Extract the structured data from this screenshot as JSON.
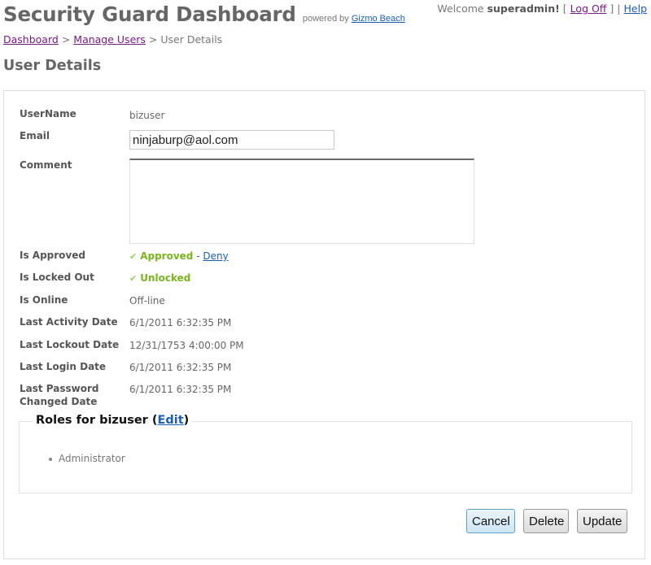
{
  "header": {
    "title": "Security Guard Dashboard",
    "powered_by": "powered by",
    "powered_link": "Gizmo Beach",
    "welcome_prefix": "Welcome",
    "username": "superadmin!",
    "bracket_open": "[",
    "logoff": "Log Off",
    "bracket_close": "]",
    "separator": "|",
    "help": "Help"
  },
  "breadcrumb": {
    "items": [
      "Dashboard",
      "Manage Users"
    ],
    "separator": ">",
    "current": "User Details"
  },
  "page_title": "User Details",
  "form": {
    "username_label": "UserName",
    "username_value": "bizuser",
    "email_label": "Email",
    "email_value": "ninjaburp@aol.com",
    "comment_label": "Comment",
    "comment_value": "",
    "approved_label": "Is Approved",
    "approved_value": "Approved",
    "approved_dash": "-",
    "deny_link": "Deny",
    "locked_label": "Is Locked Out",
    "locked_value": "Unlocked",
    "online_label": "Is Online",
    "online_value": "Off-line",
    "last_activity_label": "Last Activity Date",
    "last_activity_value": "6/1/2011 6:32:35 PM",
    "last_lockout_label": "Last Lockout Date",
    "last_lockout_value": "12/31/1753 4:00:00 PM",
    "last_login_label": "Last Login Date",
    "last_login_value": "6/1/2011 6:32:35 PM",
    "last_password_label_1": "Last Password",
    "last_password_label_2": "Changed Date",
    "last_password_value": "6/1/2011 6:32:35 PM"
  },
  "roles": {
    "title": "Roles for bizuser (",
    "edit_link": "Edit",
    "title_end": ")",
    "items": [
      "Administrator"
    ]
  },
  "buttons": {
    "cancel": "Cancel",
    "delete": "Delete",
    "update": "Update"
  },
  "icons": {
    "check": "✔"
  }
}
